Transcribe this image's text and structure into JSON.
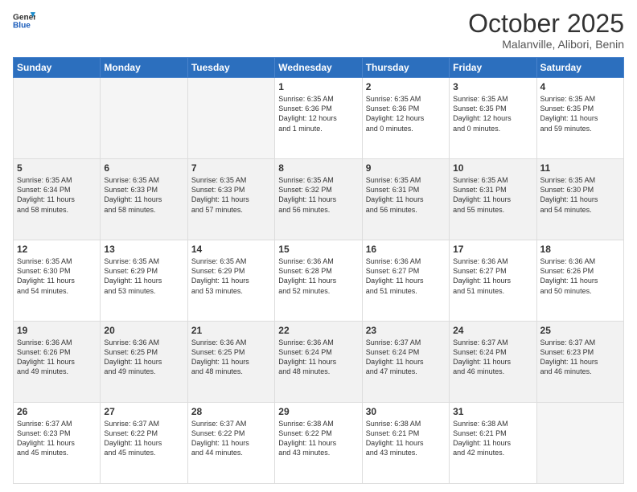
{
  "header": {
    "logo_line1": "General",
    "logo_line2": "Blue",
    "month": "October 2025",
    "location": "Malanville, Alibori, Benin"
  },
  "weekdays": [
    "Sunday",
    "Monday",
    "Tuesday",
    "Wednesday",
    "Thursday",
    "Friday",
    "Saturday"
  ],
  "weeks": [
    [
      {
        "day": "",
        "info": ""
      },
      {
        "day": "",
        "info": ""
      },
      {
        "day": "",
        "info": ""
      },
      {
        "day": "1",
        "info": "Sunrise: 6:35 AM\nSunset: 6:36 PM\nDaylight: 12 hours\nand 1 minute."
      },
      {
        "day": "2",
        "info": "Sunrise: 6:35 AM\nSunset: 6:36 PM\nDaylight: 12 hours\nand 0 minutes."
      },
      {
        "day": "3",
        "info": "Sunrise: 6:35 AM\nSunset: 6:35 PM\nDaylight: 12 hours\nand 0 minutes."
      },
      {
        "day": "4",
        "info": "Sunrise: 6:35 AM\nSunset: 6:35 PM\nDaylight: 11 hours\nand 59 minutes."
      }
    ],
    [
      {
        "day": "5",
        "info": "Sunrise: 6:35 AM\nSunset: 6:34 PM\nDaylight: 11 hours\nand 58 minutes."
      },
      {
        "day": "6",
        "info": "Sunrise: 6:35 AM\nSunset: 6:33 PM\nDaylight: 11 hours\nand 58 minutes."
      },
      {
        "day": "7",
        "info": "Sunrise: 6:35 AM\nSunset: 6:33 PM\nDaylight: 11 hours\nand 57 minutes."
      },
      {
        "day": "8",
        "info": "Sunrise: 6:35 AM\nSunset: 6:32 PM\nDaylight: 11 hours\nand 56 minutes."
      },
      {
        "day": "9",
        "info": "Sunrise: 6:35 AM\nSunset: 6:31 PM\nDaylight: 11 hours\nand 56 minutes."
      },
      {
        "day": "10",
        "info": "Sunrise: 6:35 AM\nSunset: 6:31 PM\nDaylight: 11 hours\nand 55 minutes."
      },
      {
        "day": "11",
        "info": "Sunrise: 6:35 AM\nSunset: 6:30 PM\nDaylight: 11 hours\nand 54 minutes."
      }
    ],
    [
      {
        "day": "12",
        "info": "Sunrise: 6:35 AM\nSunset: 6:30 PM\nDaylight: 11 hours\nand 54 minutes."
      },
      {
        "day": "13",
        "info": "Sunrise: 6:35 AM\nSunset: 6:29 PM\nDaylight: 11 hours\nand 53 minutes."
      },
      {
        "day": "14",
        "info": "Sunrise: 6:35 AM\nSunset: 6:29 PM\nDaylight: 11 hours\nand 53 minutes."
      },
      {
        "day": "15",
        "info": "Sunrise: 6:36 AM\nSunset: 6:28 PM\nDaylight: 11 hours\nand 52 minutes."
      },
      {
        "day": "16",
        "info": "Sunrise: 6:36 AM\nSunset: 6:27 PM\nDaylight: 11 hours\nand 51 minutes."
      },
      {
        "day": "17",
        "info": "Sunrise: 6:36 AM\nSunset: 6:27 PM\nDaylight: 11 hours\nand 51 minutes."
      },
      {
        "day": "18",
        "info": "Sunrise: 6:36 AM\nSunset: 6:26 PM\nDaylight: 11 hours\nand 50 minutes."
      }
    ],
    [
      {
        "day": "19",
        "info": "Sunrise: 6:36 AM\nSunset: 6:26 PM\nDaylight: 11 hours\nand 49 minutes."
      },
      {
        "day": "20",
        "info": "Sunrise: 6:36 AM\nSunset: 6:25 PM\nDaylight: 11 hours\nand 49 minutes."
      },
      {
        "day": "21",
        "info": "Sunrise: 6:36 AM\nSunset: 6:25 PM\nDaylight: 11 hours\nand 48 minutes."
      },
      {
        "day": "22",
        "info": "Sunrise: 6:36 AM\nSunset: 6:24 PM\nDaylight: 11 hours\nand 48 minutes."
      },
      {
        "day": "23",
        "info": "Sunrise: 6:37 AM\nSunset: 6:24 PM\nDaylight: 11 hours\nand 47 minutes."
      },
      {
        "day": "24",
        "info": "Sunrise: 6:37 AM\nSunset: 6:24 PM\nDaylight: 11 hours\nand 46 minutes."
      },
      {
        "day": "25",
        "info": "Sunrise: 6:37 AM\nSunset: 6:23 PM\nDaylight: 11 hours\nand 46 minutes."
      }
    ],
    [
      {
        "day": "26",
        "info": "Sunrise: 6:37 AM\nSunset: 6:23 PM\nDaylight: 11 hours\nand 45 minutes."
      },
      {
        "day": "27",
        "info": "Sunrise: 6:37 AM\nSunset: 6:22 PM\nDaylight: 11 hours\nand 45 minutes."
      },
      {
        "day": "28",
        "info": "Sunrise: 6:37 AM\nSunset: 6:22 PM\nDaylight: 11 hours\nand 44 minutes."
      },
      {
        "day": "29",
        "info": "Sunrise: 6:38 AM\nSunset: 6:22 PM\nDaylight: 11 hours\nand 43 minutes."
      },
      {
        "day": "30",
        "info": "Sunrise: 6:38 AM\nSunset: 6:21 PM\nDaylight: 11 hours\nand 43 minutes."
      },
      {
        "day": "31",
        "info": "Sunrise: 6:38 AM\nSunset: 6:21 PM\nDaylight: 11 hours\nand 42 minutes."
      },
      {
        "day": "",
        "info": ""
      }
    ]
  ]
}
